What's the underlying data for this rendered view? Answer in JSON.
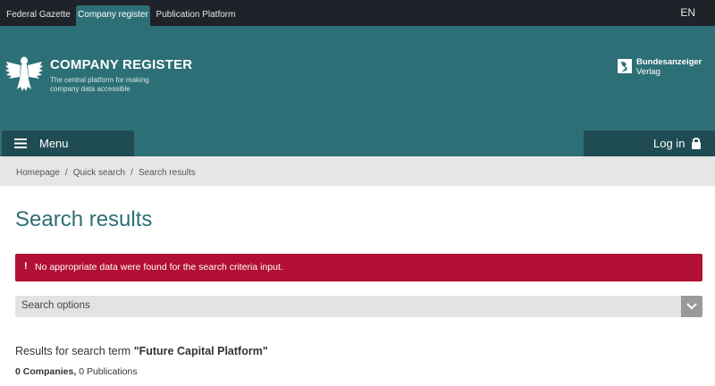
{
  "topbar": {
    "tabs": [
      {
        "label": "Federal Gazette"
      },
      {
        "label": "Company register"
      },
      {
        "label": "Publication Platform"
      }
    ],
    "language": "EN"
  },
  "header": {
    "title": "COMPANY REGISTER",
    "subtitle": "The central platform for making company data accessible",
    "partner_line1": "Bundesanzeiger",
    "partner_line2": "Verlag",
    "menu_label": "Menu",
    "login_label": "Log in"
  },
  "breadcrumb": {
    "items": [
      "Homepage",
      "Quick search",
      "Search results"
    ],
    "separator": "/"
  },
  "main": {
    "title": "Search results",
    "alert": {
      "icon": "!",
      "text": "No appropriate data were found for the search criteria input."
    },
    "search_options_label": "Search options",
    "results_prefix": "Results for search term ",
    "search_term": "\"Future Capital Platform\"",
    "companies_count": "0 Companies,",
    "publications_count": "0 Publications"
  },
  "colors": {
    "topbar_bg": "#1f2228",
    "header_bg": "#2d6f76",
    "button_bg": "#1f4c52",
    "alert_bg": "#b10f34",
    "title_color": "#2d6f76"
  },
  "icons": [
    "eagle-logo-icon",
    "bundesanzeiger-logo-icon",
    "hamburger-menu-icon",
    "lock-icon",
    "alert-exclamation-icon",
    "chevron-down-icon"
  ]
}
